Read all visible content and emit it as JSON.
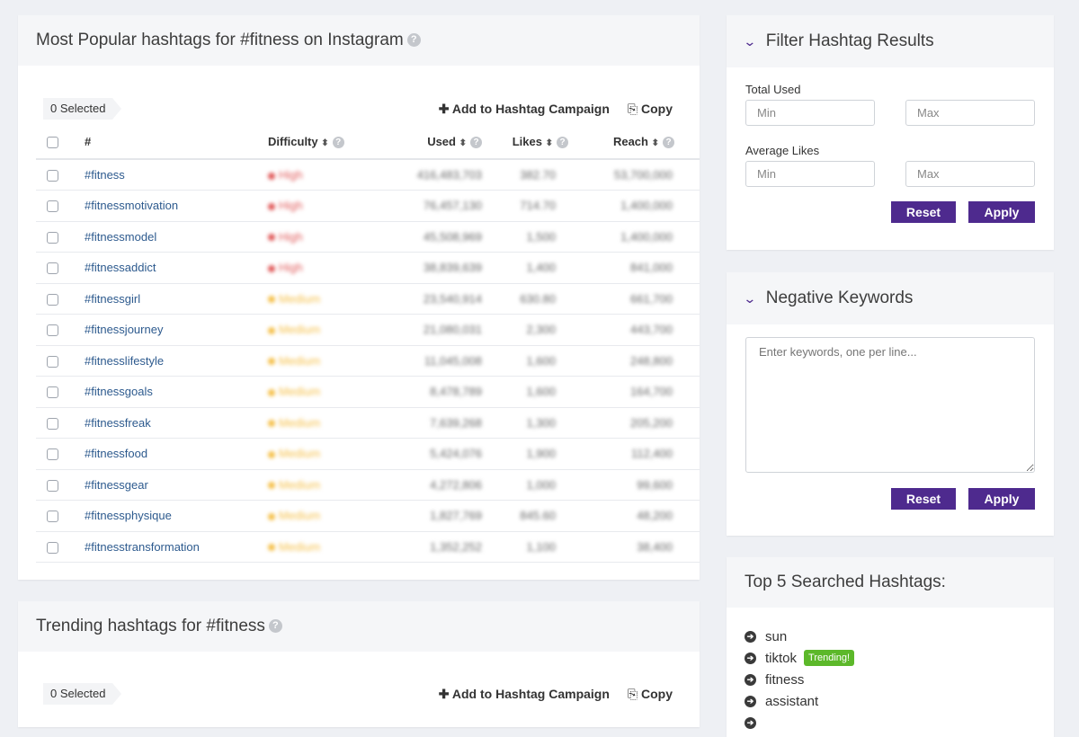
{
  "popular": {
    "title": "Most Popular hashtags for #fitness on Instagram",
    "selected": "0 Selected",
    "add_campaign": "Add to Hashtag Campaign",
    "copy": "Copy",
    "columns": {
      "hash": "#",
      "difficulty": "Difficulty",
      "used": "Used",
      "likes": "Likes",
      "reach": "Reach"
    },
    "rows": [
      {
        "tag": "#fitness",
        "difficulty": "High",
        "used": "416,483,703",
        "likes": "382.70",
        "reach": "53,700,000"
      },
      {
        "tag": "#fitnessmotivation",
        "difficulty": "High",
        "used": "76,457,130",
        "likes": "714.70",
        "reach": "1,400,000"
      },
      {
        "tag": "#fitnessmodel",
        "difficulty": "High",
        "used": "45,508,969",
        "likes": "1,500",
        "reach": "1,400,000"
      },
      {
        "tag": "#fitnessaddict",
        "difficulty": "High",
        "used": "38,839,639",
        "likes": "1,400",
        "reach": "841,000"
      },
      {
        "tag": "#fitnessgirl",
        "difficulty": "Medium",
        "used": "23,540,914",
        "likes": "630.80",
        "reach": "661,700"
      },
      {
        "tag": "#fitnessjourney",
        "difficulty": "Medium",
        "used": "21,080,031",
        "likes": "2,300",
        "reach": "443,700"
      },
      {
        "tag": "#fitnesslifestyle",
        "difficulty": "Medium",
        "used": "11,045,008",
        "likes": "1,600",
        "reach": "248,800"
      },
      {
        "tag": "#fitnessgoals",
        "difficulty": "Medium",
        "used": "8,478,789",
        "likes": "1,600",
        "reach": "164,700"
      },
      {
        "tag": "#fitnessfreak",
        "difficulty": "Medium",
        "used": "7,639,268",
        "likes": "1,300",
        "reach": "205,200"
      },
      {
        "tag": "#fitnessfood",
        "difficulty": "Medium",
        "used": "5,424,076",
        "likes": "1,900",
        "reach": "112,400"
      },
      {
        "tag": "#fitnessgear",
        "difficulty": "Medium",
        "used": "4,272,806",
        "likes": "1,000",
        "reach": "99,600"
      },
      {
        "tag": "#fitnessphysique",
        "difficulty": "Medium",
        "used": "1,827,769",
        "likes": "845.60",
        "reach": "48,200"
      },
      {
        "tag": "#fitnesstransformation",
        "difficulty": "Medium",
        "used": "1,352,252",
        "likes": "1,100",
        "reach": "38,400"
      }
    ]
  },
  "trending": {
    "title": "Trending hashtags for #fitness",
    "selected": "0 Selected",
    "add_campaign": "Add to Hashtag Campaign",
    "copy": "Copy"
  },
  "filter": {
    "title": "Filter Hashtag Results",
    "total_used_label": "Total Used",
    "avg_likes_label": "Average Likes",
    "min_placeholder": "Min",
    "max_placeholder": "Max",
    "reset": "Reset",
    "apply": "Apply"
  },
  "negative": {
    "title": "Negative Keywords",
    "placeholder": "Enter keywords, one per line...",
    "reset": "Reset",
    "apply": "Apply"
  },
  "top5": {
    "title": "Top 5 Searched Hashtags:",
    "items": [
      "sun",
      "tiktok",
      "fitness",
      "assistant"
    ],
    "trending_badge": "Trending!"
  },
  "colors": {
    "high": "#e05a5a",
    "medium": "#f5c04a",
    "brand": "#4e2a8e",
    "trending": "#5cb82a"
  }
}
